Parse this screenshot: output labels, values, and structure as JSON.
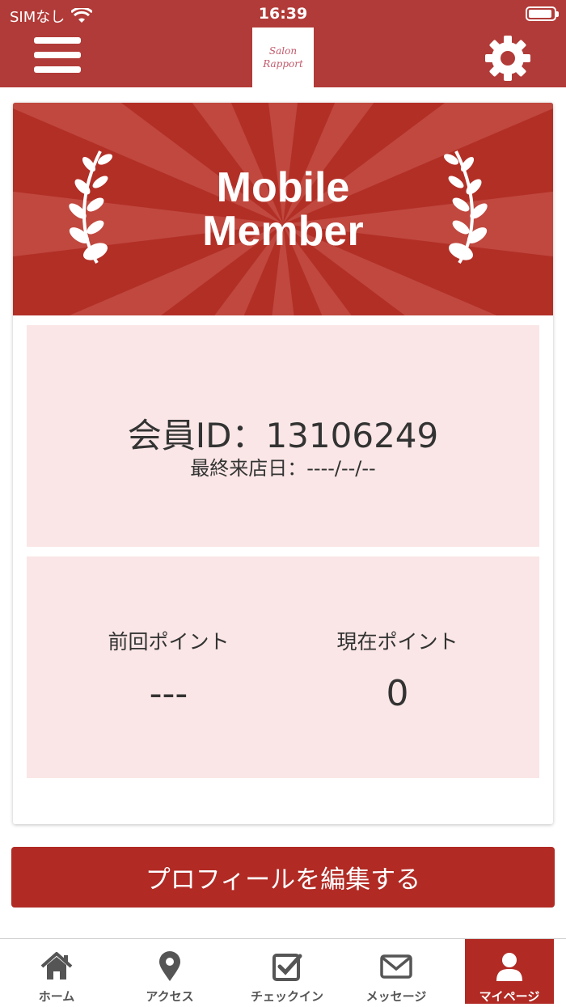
{
  "status_bar": {
    "carrier": "SIMなし",
    "time": "16:39"
  },
  "header": {
    "logo_line1": "Salon",
    "logo_line2": "Rapport"
  },
  "banner": {
    "title_line1": "Mobile",
    "title_line2": "Member"
  },
  "member": {
    "id_text": "会員ID：13106249",
    "last_visit": "最終来店日：----/--/--"
  },
  "points": {
    "previous_label": "前回ポイント",
    "previous_value": "---",
    "current_label": "現在ポイント",
    "current_value": "0"
  },
  "edit_profile_label": "プロフィールを編集する",
  "tabs": [
    {
      "label": "ホーム",
      "icon": "home-icon"
    },
    {
      "label": "アクセス",
      "icon": "map-pin-icon"
    },
    {
      "label": "チェックイン",
      "icon": "check-square-icon"
    },
    {
      "label": "メッセージ",
      "icon": "envelope-icon"
    },
    {
      "label": "マイページ",
      "icon": "user-icon",
      "active": true
    }
  ],
  "colors": {
    "brand_red": "#b13b38",
    "panel_pink": "#fae6e6",
    "button_red": "#b12a24"
  }
}
